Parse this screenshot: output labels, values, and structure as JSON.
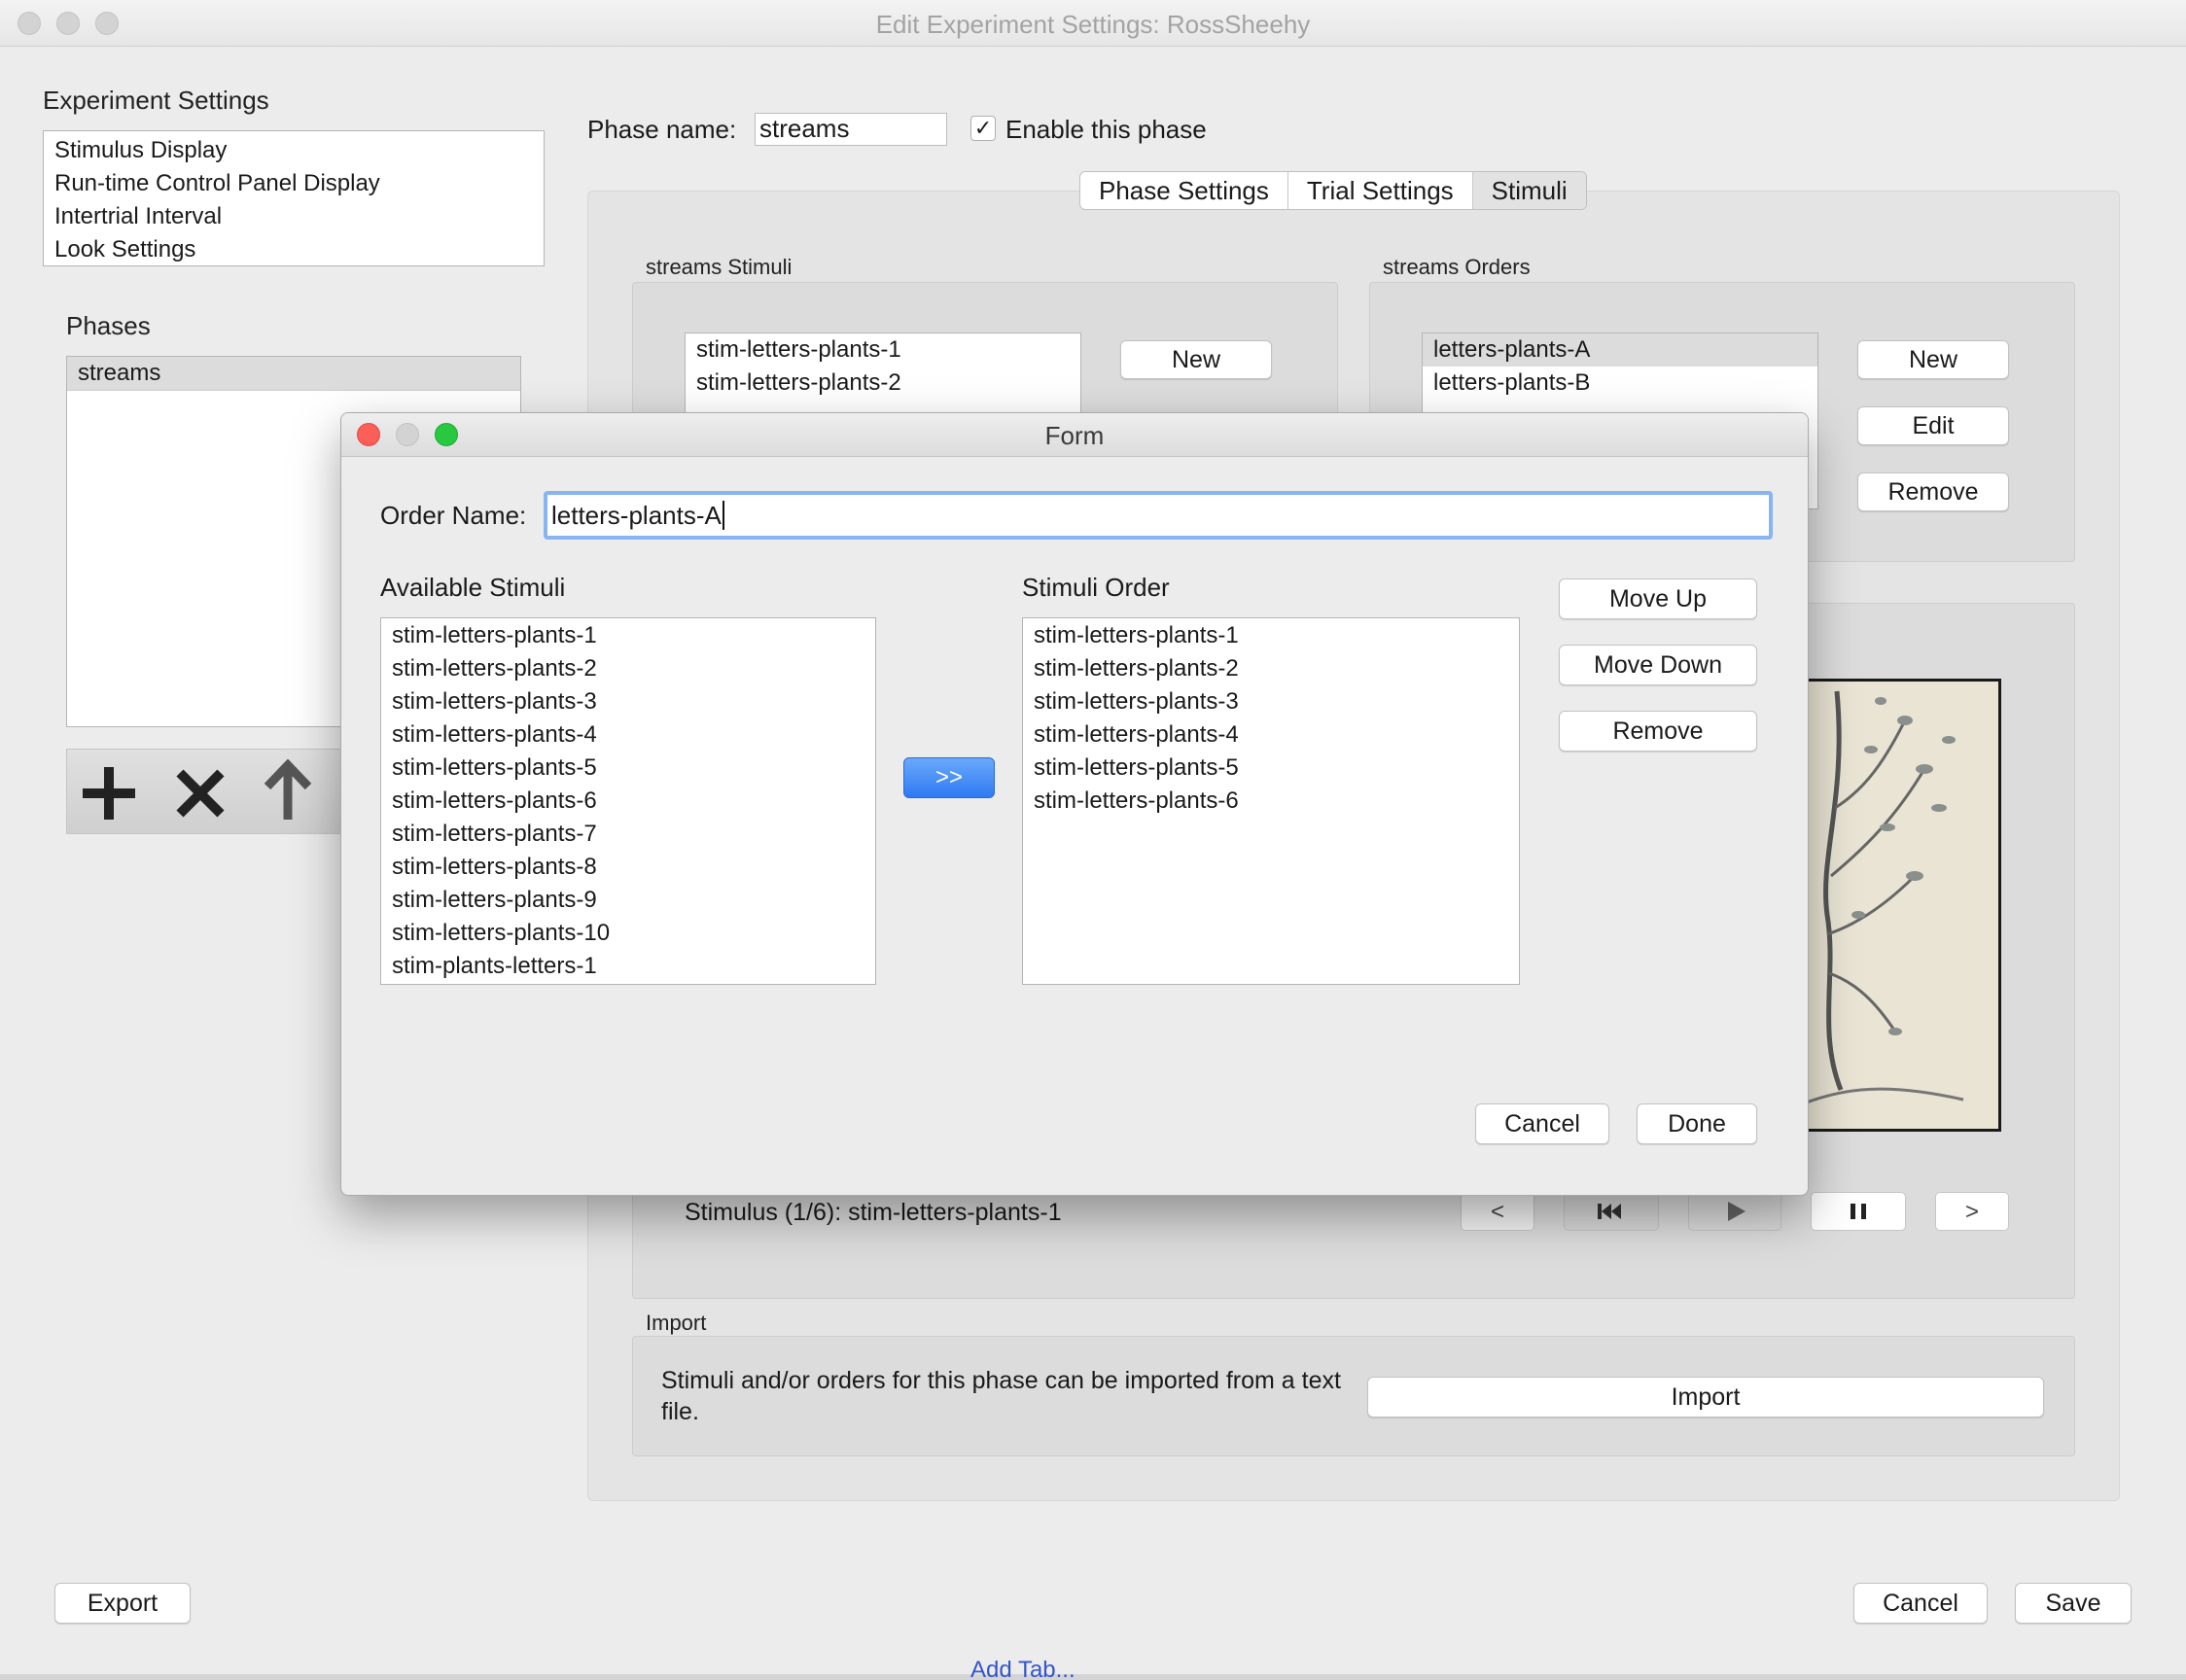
{
  "window": {
    "title": "Edit Experiment Settings: RossSheehy"
  },
  "experiment_settings": {
    "label": "Experiment Settings",
    "items": [
      "Stimulus Display",
      "Run-time Control Panel Display",
      "Intertrial Interval",
      "Look Settings"
    ]
  },
  "phases": {
    "label": "Phases",
    "items": [
      "streams"
    ],
    "toolbar": {
      "add_icon": "plus-icon",
      "remove_icon": "x-icon",
      "up_icon": "arrow-up-icon"
    }
  },
  "phase": {
    "name_label": "Phase name:",
    "name_value": "streams",
    "enable_checked": true,
    "enable_label": "Enable this phase"
  },
  "tabs": [
    "Phase Settings",
    "Trial Settings",
    "Stimuli"
  ],
  "stimuli_box": {
    "label": "streams Stimuli",
    "items": [
      "stim-letters-plants-1",
      "stim-letters-plants-2"
    ],
    "new_label": "New"
  },
  "orders_box": {
    "label": "streams Orders",
    "items": [
      "letters-plants-A",
      "letters-plants-B"
    ],
    "new_label": "New",
    "edit_label": "Edit",
    "remove_label": "Remove"
  },
  "player": {
    "stimulus_text": "Stimulus (1/6): stim-letters-plants-1",
    "prev_label": "<",
    "next_label": ">",
    "icons": {
      "rewind": "skip-back-icon",
      "play": "play-icon",
      "pause": "pause-icon"
    }
  },
  "import": {
    "label": "Import",
    "description": "Stimuli and/or orders for this phase can be imported from a text file.",
    "button_label": "Import"
  },
  "bottom": {
    "export_label": "Export",
    "cancel_label": "Cancel",
    "save_label": "Save"
  },
  "behind_text": "Add Tab...",
  "form": {
    "title": "Form",
    "order_name_label": "Order Name:",
    "order_name_value": "letters-plants-A",
    "available_label": "Available Stimuli",
    "available_items": [
      "stim-letters-plants-1",
      "stim-letters-plants-2",
      "stim-letters-plants-3",
      "stim-letters-plants-4",
      "stim-letters-plants-5",
      "stim-letters-plants-6",
      "stim-letters-plants-7",
      "stim-letters-plants-8",
      "stim-letters-plants-9",
      "stim-letters-plants-10",
      "stim-plants-letters-1"
    ],
    "add_label": ">>",
    "order_label": "Stimuli Order",
    "order_items": [
      "stim-letters-plants-1",
      "stim-letters-plants-2",
      "stim-letters-plants-3",
      "stim-letters-plants-4",
      "stim-letters-plants-5",
      "stim-letters-plants-6"
    ],
    "move_up_label": "Move Up",
    "move_down_label": "Move Down",
    "remove_label": "Remove",
    "cancel_label": "Cancel",
    "done_label": "Done"
  },
  "colors": {
    "accent": "#3b86f7",
    "close": "#fc5f57",
    "minimize": "#fdbc2e",
    "zoom": "#28c840"
  }
}
